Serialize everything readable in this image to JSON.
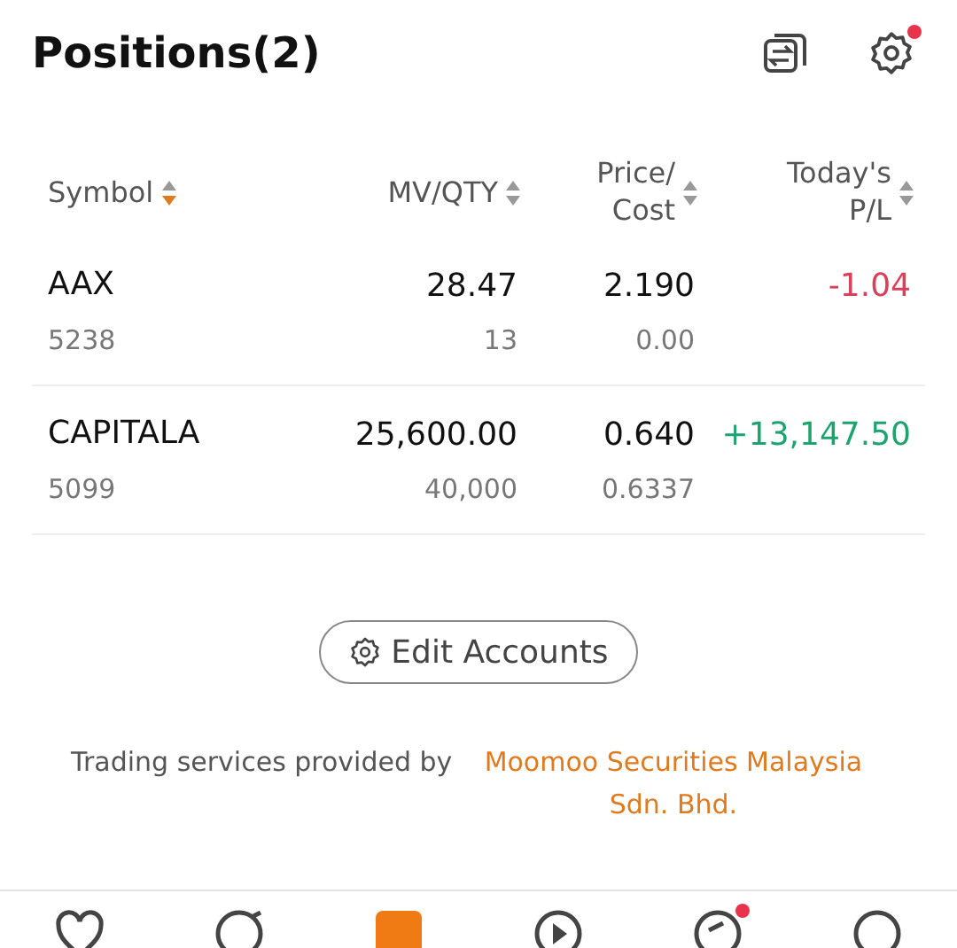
{
  "header": {
    "title": "Positions(2)",
    "settings_badge": true
  },
  "table": {
    "columns": [
      {
        "label": "Symbol",
        "sorted": true
      },
      {
        "label": "MV/QTY",
        "sorted": false
      },
      {
        "label": "Price/ Cost",
        "sorted": false
      },
      {
        "label": "Today's P/L",
        "sorted": false
      }
    ],
    "rows": [
      {
        "symbol": "AAX",
        "code": "5238",
        "mv": "28.47",
        "qty": "13",
        "price": "2.190",
        "cost": "0.00",
        "pl": "-1.04",
        "kind": "loss"
      },
      {
        "symbol": "CAPITALA",
        "code": "5099",
        "mv": "25,600.00",
        "qty": "40,000",
        "price": "0.640",
        "cost": "0.6337",
        "pl": "+13,147.50",
        "kind": "gain"
      }
    ]
  },
  "edit_button": {
    "label": "Edit Accounts"
  },
  "footer": {
    "text": "Trading services provided by",
    "link": "Moomoo Securities Malaysia Sdn. Bhd."
  },
  "nav": [
    {
      "kind": "heart",
      "selected": false,
      "badge": false
    },
    {
      "kind": "bubble",
      "selected": false,
      "badge": false
    },
    {
      "kind": "square",
      "selected": true,
      "badge": false
    },
    {
      "kind": "play",
      "selected": false,
      "badge": false
    },
    {
      "kind": "compass",
      "selected": false,
      "badge": true
    },
    {
      "kind": "circle",
      "selected": false,
      "badge": false
    }
  ]
}
